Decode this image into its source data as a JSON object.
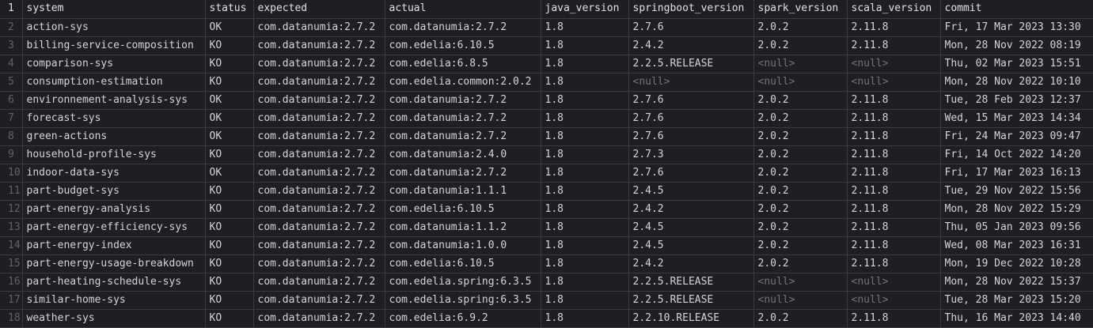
{
  "columns": [
    "system",
    "status",
    "expected",
    "actual",
    "java_version",
    "springboot_version",
    "spark_version",
    "scala_version",
    "commit"
  ],
  "rows": [
    [
      "action-sys",
      "OK",
      "com.datanumia:2.7.2",
      "com.datanumia:2.7.2",
      "1.8",
      "2.7.6",
      "2.0.2",
      "2.11.8",
      "Fri, 17 Mar 2023 13:30"
    ],
    [
      "billing-service-composition",
      "KO",
      "com.datanumia:2.7.2",
      "com.edelia:6.10.5",
      "1.8",
      "2.4.2",
      "2.0.2",
      "2.11.8",
      "Mon, 28 Nov 2022 08:19"
    ],
    [
      "comparison-sys",
      "KO",
      "com.datanumia:2.7.2",
      "com.edelia:6.8.5",
      "1.8",
      "2.2.5.RELEASE",
      "<null>",
      "<null>",
      "Thu, 02 Mar 2023 15:51"
    ],
    [
      "consumption-estimation",
      "KO",
      "com.datanumia:2.7.2",
      "com.edelia.common:2.0.2",
      "1.8",
      "<null>",
      "<null>",
      "<null>",
      "Mon, 28 Nov 2022 10:10"
    ],
    [
      "environnement-analysis-sys",
      "OK",
      "com.datanumia:2.7.2",
      "com.datanumia:2.7.2",
      "1.8",
      "2.7.6",
      "2.0.2",
      "2.11.8",
      "Tue, 28 Feb 2023 12:37"
    ],
    [
      "forecast-sys",
      "OK",
      "com.datanumia:2.7.2",
      "com.datanumia:2.7.2",
      "1.8",
      "2.7.6",
      "2.0.2",
      "2.11.8",
      "Wed, 15 Mar 2023 14:34"
    ],
    [
      "green-actions",
      "OK",
      "com.datanumia:2.7.2",
      "com.datanumia:2.7.2",
      "1.8",
      "2.7.6",
      "2.0.2",
      "2.11.8",
      "Fri, 24 Mar 2023 09:47"
    ],
    [
      "household-profile-sys",
      "KO",
      "com.datanumia:2.7.2",
      "com.datanumia:2.4.0",
      "1.8",
      "2.7.3",
      "2.0.2",
      "2.11.8",
      "Fri, 14 Oct 2022 14:20"
    ],
    [
      "indoor-data-sys",
      "OK",
      "com.datanumia:2.7.2",
      "com.datanumia:2.7.2",
      "1.8",
      "2.7.6",
      "2.0.2",
      "2.11.8",
      "Fri, 17 Mar 2023 16:13"
    ],
    [
      "part-budget-sys",
      "KO",
      "com.datanumia:2.7.2",
      "com.datanumia:1.1.1",
      "1.8",
      "2.4.5",
      "2.0.2",
      "2.11.8",
      "Tue, 29 Nov 2022 15:56"
    ],
    [
      "part-energy-analysis",
      "KO",
      "com.datanumia:2.7.2",
      "com.edelia:6.10.5",
      "1.8",
      "2.4.2",
      "2.0.2",
      "2.11.8",
      "Mon, 28 Nov 2022 15:29"
    ],
    [
      "part-energy-efficiency-sys",
      "KO",
      "com.datanumia:2.7.2",
      "com.datanumia:1.1.2",
      "1.8",
      "2.4.5",
      "2.0.2",
      "2.11.8",
      "Thu, 05 Jan 2023 09:56"
    ],
    [
      "part-energy-index",
      "KO",
      "com.datanumia:2.7.2",
      "com.datanumia:1.0.0",
      "1.8",
      "2.4.5",
      "2.0.2",
      "2.11.8",
      "Wed, 08 Mar 2023 16:31"
    ],
    [
      "part-energy-usage-breakdown",
      "KO",
      "com.datanumia:2.7.2",
      "com.edelia:6.10.5",
      "1.8",
      "2.4.2",
      "2.0.2",
      "2.11.8",
      "Mon, 19 Dec 2022 10:28"
    ],
    [
      "part-heating-schedule-sys",
      "KO",
      "com.datanumia:2.7.2",
      "com.edelia.spring:6.3.5",
      "1.8",
      "2.2.5.RELEASE",
      "<null>",
      "<null>",
      "Mon, 28 Nov 2022 15:37"
    ],
    [
      "similar-home-sys",
      "KO",
      "com.datanumia:2.7.2",
      "com.edelia.spring:6.3.5",
      "1.8",
      "2.2.5.RELEASE",
      "<null>",
      "<null>",
      "Tue, 28 Mar 2023 15:20"
    ],
    [
      "weather-sys",
      "KO",
      "com.datanumia:2.7.2",
      "com.edelia:6.9.2",
      "1.8",
      "2.2.10.RELEASE",
      "2.0.2",
      "2.11.8",
      "Thu, 16 Mar 2023 14:40"
    ]
  ],
  "colors": {
    "background": "#1e1f22",
    "text": "#d4d4d4",
    "null_text": "#6f737a",
    "line_number": "#5f6268",
    "grid": "#393b40"
  }
}
